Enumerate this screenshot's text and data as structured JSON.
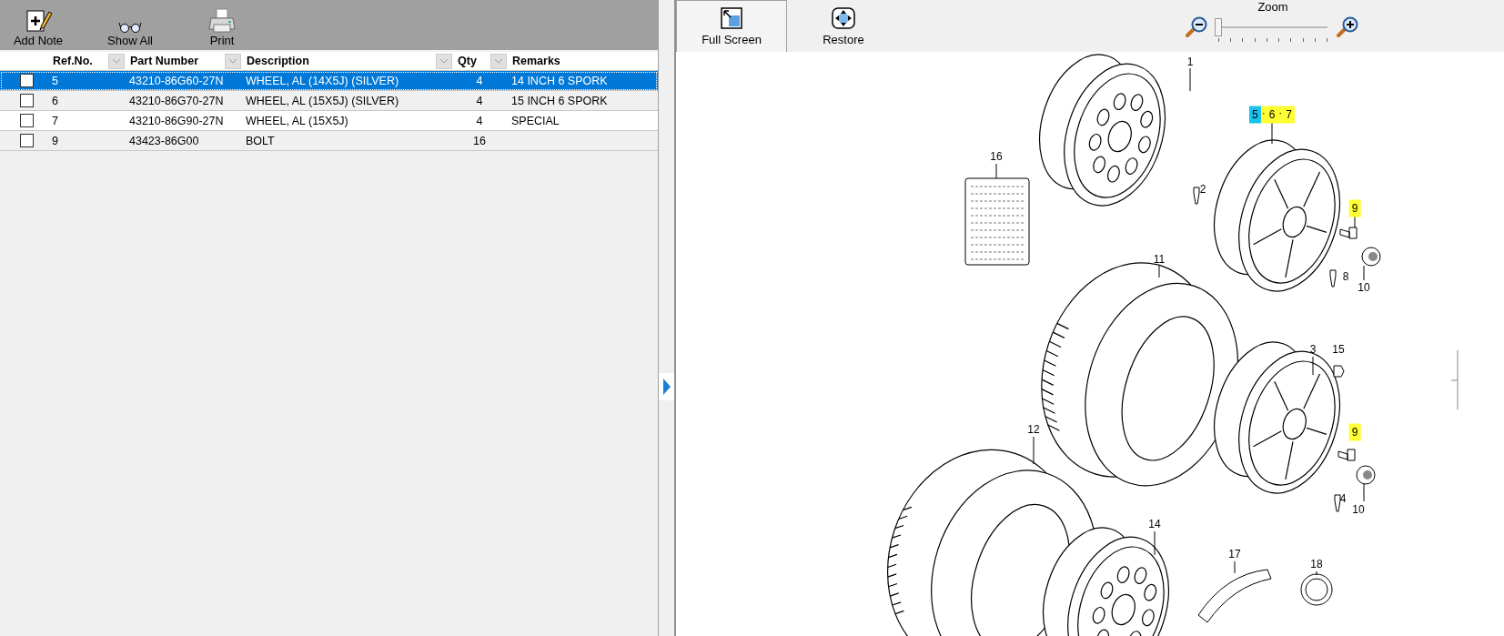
{
  "toolbar": {
    "buttons": [
      {
        "label": "Add Note"
      },
      {
        "label": "Show All"
      },
      {
        "label": "Print"
      }
    ]
  },
  "table": {
    "columns": [
      {
        "label": "Ref.No.",
        "filter": true
      },
      {
        "label": "Part Number",
        "filter": true
      },
      {
        "label": "Description",
        "filter": true
      },
      {
        "label": "Qty",
        "filter": true
      },
      {
        "label": "Remarks",
        "filter": false
      }
    ],
    "rows": [
      {
        "checked": false,
        "selected": true,
        "cells": [
          "5",
          "43210-86G60-27N",
          "WHEEL, AL (14X5J) (SILVER)",
          "4",
          "14 INCH 6 SPORK"
        ]
      },
      {
        "checked": false,
        "selected": false,
        "cells": [
          "6",
          "43210-86G70-27N",
          "WHEEL, AL (15X5J) (SILVER)",
          "4",
          "15 INCH 6 SPORK"
        ]
      },
      {
        "checked": false,
        "selected": false,
        "cells": [
          "7",
          "43210-86G90-27N",
          "WHEEL, AL (15X5J)",
          "4",
          "SPECIAL"
        ]
      },
      {
        "checked": false,
        "selected": false,
        "cells": [
          "9",
          "43423-86G00",
          "BOLT",
          "16",
          ""
        ]
      }
    ]
  },
  "viewer": {
    "buttons": [
      {
        "label": "Full Screen",
        "pressed": true
      },
      {
        "label": "Restore",
        "pressed": false
      }
    ],
    "zoom": {
      "label": "Zoom",
      "level": 0
    }
  },
  "diagram": {
    "callouts": [
      {
        "parts": [
          {
            "label": "1"
          }
        ]
      },
      {
        "parts": [
          {
            "label": "2"
          }
        ]
      },
      {
        "parts": [
          {
            "label": "5",
            "color": "#19c3ee"
          },
          {
            "label": "6",
            "color": "#ffff33"
          },
          {
            "label": "7",
            "color": "#ffff33"
          }
        ],
        "separator": "·"
      },
      {
        "parts": [
          {
            "label": "9",
            "color": "#ffff33"
          }
        ]
      },
      {
        "parts": [
          {
            "label": "8"
          }
        ]
      },
      {
        "parts": [
          {
            "label": "10"
          }
        ]
      },
      {
        "parts": [
          {
            "label": "16"
          }
        ]
      },
      {
        "parts": [
          {
            "label": "11"
          }
        ]
      },
      {
        "parts": [
          {
            "label": "3"
          }
        ]
      },
      {
        "parts": [
          {
            "label": "15"
          }
        ]
      },
      {
        "parts": [
          {
            "label": "9",
            "color": "#ffff33"
          }
        ]
      },
      {
        "parts": [
          {
            "label": "4"
          }
        ]
      },
      {
        "parts": [
          {
            "label": "10"
          }
        ]
      },
      {
        "parts": [
          {
            "label": "12"
          }
        ]
      },
      {
        "parts": [
          {
            "label": "14"
          }
        ]
      },
      {
        "parts": [
          {
            "label": "17"
          }
        ]
      },
      {
        "parts": [
          {
            "label": "18"
          }
        ]
      }
    ]
  }
}
